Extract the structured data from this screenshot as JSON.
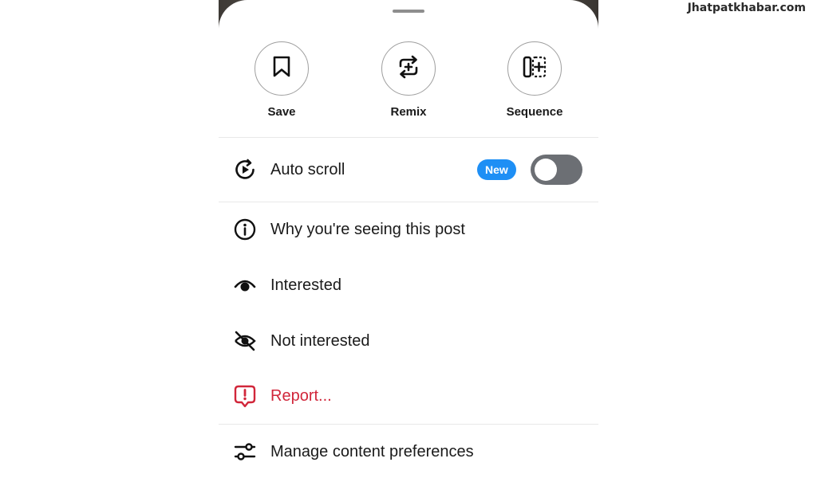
{
  "watermark": "Jhatpatkhabar.com",
  "actions": [
    {
      "label": "Save",
      "icon": "bookmark-icon"
    },
    {
      "label": "Remix",
      "icon": "remix-icon"
    },
    {
      "label": "Sequence",
      "icon": "sequence-icon"
    }
  ],
  "auto_scroll": {
    "label": "Auto scroll",
    "icon": "auto-scroll-icon",
    "badge": "New",
    "toggle_on": false,
    "badge_color": "#1e8ff5",
    "toggle_color": "#6c6f74"
  },
  "menu": [
    {
      "label": "Why you're seeing this post",
      "icon": "info-icon"
    },
    {
      "label": "Interested",
      "icon": "eye-icon"
    },
    {
      "label": "Not interested",
      "icon": "eye-off-icon"
    },
    {
      "label": "Report...",
      "icon": "report-icon",
      "color": "#d1263a"
    },
    {
      "label": "Manage content preferences",
      "icon": "sliders-icon"
    }
  ]
}
